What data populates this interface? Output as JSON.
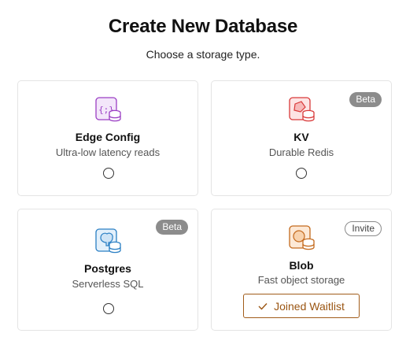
{
  "header": {
    "title": "Create New Database",
    "subtitle": "Choose a storage type."
  },
  "options": [
    {
      "name": "Edge Config",
      "description": "Ultra-low latency reads",
      "icon": "edge-config-icon",
      "badge": "",
      "selected": false
    },
    {
      "name": "KV",
      "description": "Durable Redis",
      "icon": "kv-icon",
      "badge": "Beta",
      "selected": false
    },
    {
      "name": "Postgres",
      "description": "Serverless SQL",
      "icon": "postgres-icon",
      "badge": "Beta",
      "selected": false
    },
    {
      "name": "Blob",
      "description": "Fast object storage",
      "icon": "blob-icon",
      "badge": "Invite",
      "action_label": "Joined Waitlist"
    }
  ],
  "colors": {
    "edge_config_accent": "#9b3fc4",
    "kv_accent": "#d93a3a",
    "postgres_accent": "#2a7fc4",
    "blob_accent": "#c46a1d",
    "beta_badge_bg": "#8c8c8c",
    "waitlist_accent": "#9a5512"
  }
}
